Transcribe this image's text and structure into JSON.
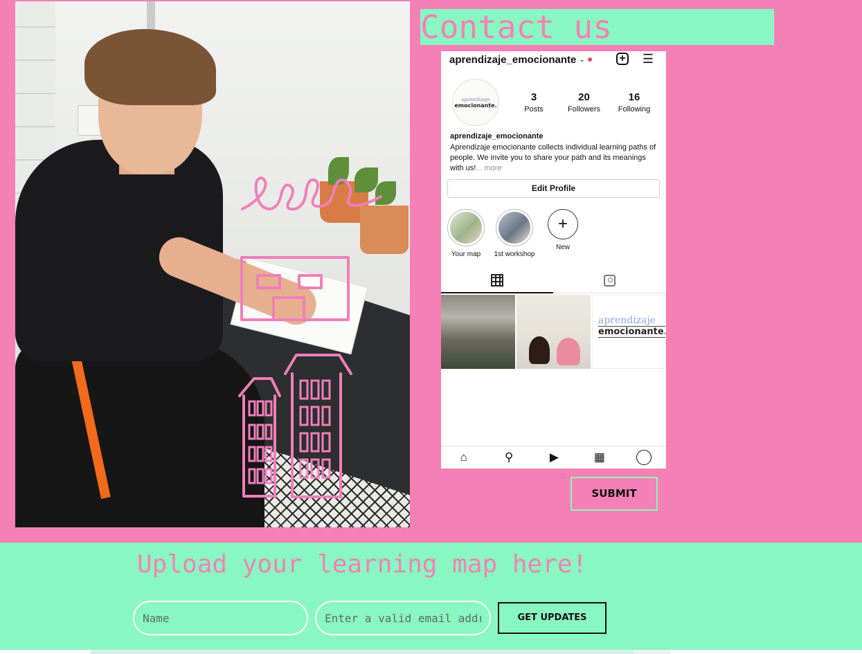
{
  "contact": {
    "title": "Contact us"
  },
  "instagram": {
    "username": "aprendizaje_emocionante",
    "avatar": {
      "line1": "aprendizaje",
      "line2": "emocionante."
    },
    "stats": [
      {
        "value": "3",
        "label": "Posts"
      },
      {
        "value": "20",
        "label": "Followers"
      },
      {
        "value": "16",
        "label": "Following"
      }
    ],
    "bio_name": "aprendizaje_emocionante",
    "bio_text": "Aprendizaje emocionante collects individual learning paths of people. We invite you to share your path and its meanings with us!",
    "bio_more": "... more",
    "edit_profile": "Edit Profile",
    "highlights": [
      {
        "label": "Your map"
      },
      {
        "label": "1st workshop"
      },
      {
        "label": "New"
      }
    ],
    "post3": {
      "line1": "aprendizaje",
      "line2": "emocionante."
    },
    "icons": {
      "add": "plus-square-icon",
      "menu": "hamburger-icon",
      "grid": "grid-icon",
      "tagged": "tagged-icon",
      "home": "home-icon",
      "search": "search-icon",
      "reels": "reels-icon",
      "shop": "shop-icon",
      "profile": "profile-icon"
    }
  },
  "contact_form": {
    "submit_label": "SUBMIT"
  },
  "upload": {
    "title": "Upload your learning map here!",
    "name_placeholder": "Name",
    "email_placeholder": "Enter a valid email address",
    "button_label": "GET UPDATES"
  },
  "colors": {
    "pink": "#f580b6",
    "mint": "#89f7c1",
    "dark": "#111111"
  }
}
